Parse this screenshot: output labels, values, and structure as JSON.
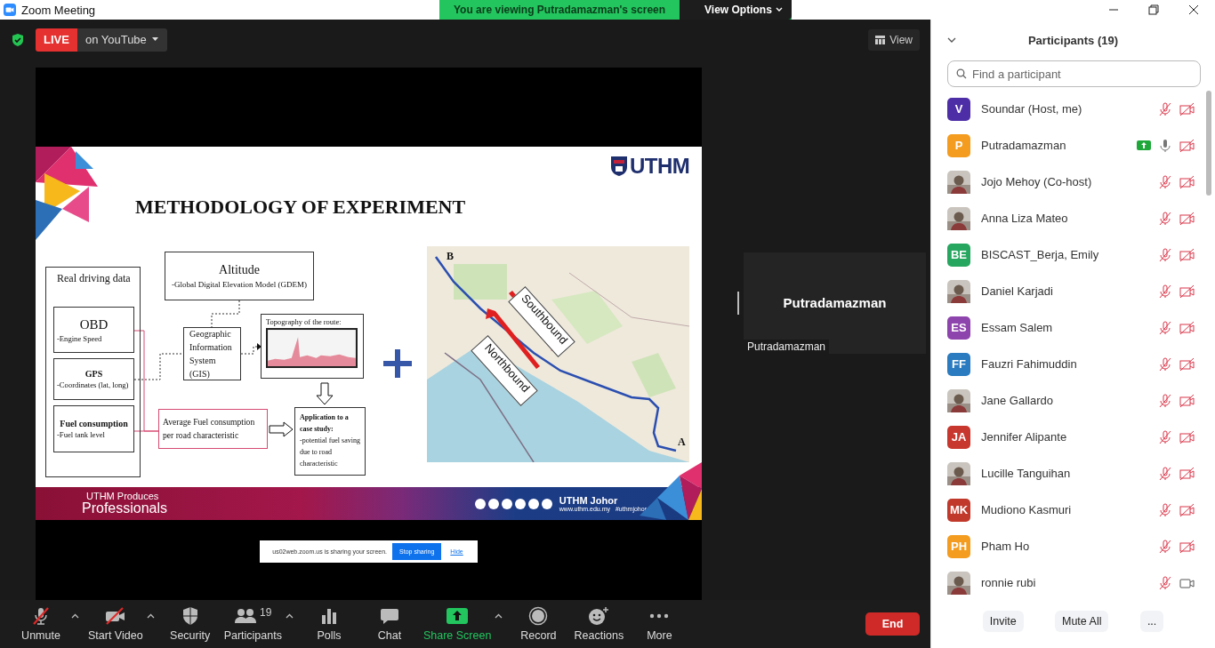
{
  "window": {
    "title": "Zoom Meeting"
  },
  "banner": {
    "text": "You are viewing Putradamazman's screen",
    "menu": "View Options"
  },
  "live": {
    "badge": "LIVE",
    "platform": "on YouTube"
  },
  "view_button": "View",
  "slide": {
    "logo": "UTHM",
    "title": "METHODOLOGY OF EXPERIMENT",
    "driving_data": {
      "title": "Real driving data",
      "items": [
        {
          "title": "OBD",
          "detail": "-Engine Speed",
          "bold": false
        },
        {
          "title": "GPS",
          "detail": "-Coordinates (lat, long)",
          "bold": true
        },
        {
          "title": "Fuel consumption",
          "detail": "-Fuel tank level",
          "bold": true
        }
      ]
    },
    "altitude": {
      "title": "Altitude",
      "detail": "-Global Digital Elevation Model (GDEM)"
    },
    "gis": "Geographic Information System (GIS)",
    "topography": "Topography of the route:",
    "average": "Average Fuel consumption per road characteristic",
    "application": {
      "title": "Application to a case study:",
      "detail": "-potential fuel saving due to road characteristic"
    },
    "map": {
      "kind": "picture",
      "labels": [
        "Southbound",
        "Northbound"
      ],
      "points": [
        "B",
        "A"
      ]
    },
    "footer": {
      "tagline": "UTHM Produces",
      "headline": "Professionals",
      "brand": "UTHM Johor",
      "website": "www.uthm.edu.my",
      "hashtag": "#uthmjohor"
    }
  },
  "share_notice": {
    "text": "us02web.zoom.us is sharing your screen.",
    "stop": "Stop sharing",
    "hide": "Hide"
  },
  "video_tile": {
    "name": "Putradamazman",
    "label": "Putradamazman"
  },
  "participants_panel": {
    "title": "Participants (19)",
    "search": {
      "placeholder": "Find a participant"
    },
    "participants": [
      {
        "name": "Soundar (Host, me)",
        "avatar": {
          "kind": "initials",
          "text": "V",
          "color": "#4e2ea6"
        },
        "sharing": false,
        "muted": true,
        "video_off": true
      },
      {
        "name": "Putradamazman",
        "avatar": {
          "kind": "initials",
          "text": "P",
          "color": "#f39c1f"
        },
        "sharing": true,
        "muted": false,
        "video_off": true
      },
      {
        "name": "Jojo Mehoy (Co-host)",
        "sharing": false,
        "muted": true,
        "video_off": true
      },
      {
        "name": "Anna Liza Mateo",
        "sharing": false,
        "muted": true,
        "video_off": true
      },
      {
        "name": "BISCAST_Berja, Emily",
        "avatar": {
          "kind": "initials",
          "text": "BE",
          "color": "#27a660"
        },
        "sharing": false,
        "muted": true,
        "video_off": true
      },
      {
        "name": "Daniel Karjadi",
        "sharing": false,
        "muted": true,
        "video_off": true
      },
      {
        "name": "Essam Salem",
        "avatar": {
          "kind": "initials",
          "text": "ES",
          "color": "#8e44ad"
        },
        "sharing": false,
        "muted": true,
        "video_off": true
      },
      {
        "name": "Fauzri Fahimuddin",
        "avatar": {
          "kind": "initials",
          "text": "FF",
          "color": "#2a7bbf"
        },
        "sharing": false,
        "muted": true,
        "video_off": true
      },
      {
        "name": "Jane Gallardo",
        "sharing": false,
        "muted": true,
        "video_off": true
      },
      {
        "name": "Jennifer Alipante",
        "avatar": {
          "kind": "initials",
          "text": "JA",
          "color": "#c8372d"
        },
        "sharing": false,
        "muted": true,
        "video_off": true
      },
      {
        "name": "Lucille Tanguihan",
        "sharing": false,
        "muted": true,
        "video_off": true
      },
      {
        "name": "Mudiono Kasmuri",
        "avatar": {
          "kind": "initials",
          "text": "MK",
          "color": "#c0392b"
        },
        "sharing": false,
        "muted": true,
        "video_off": true
      },
      {
        "name": "Pham Ho",
        "avatar": {
          "kind": "initials",
          "text": "PH",
          "color": "#f39c1f"
        },
        "sharing": false,
        "muted": true,
        "video_off": true
      },
      {
        "name": "ronnie rubi",
        "sharing": false,
        "muted": true,
        "video_off": false
      }
    ],
    "buttons": [
      "Invite",
      "Mute All",
      "..."
    ]
  },
  "toolbar": [
    {
      "kind": "mic",
      "label": "Unmute",
      "menu": true,
      "off": true
    },
    {
      "kind": "video",
      "label": "Start Video",
      "menu": true,
      "off": true
    },
    {
      "kind": "security",
      "label": "Security",
      "menu": false
    },
    {
      "kind": "participants",
      "label": "Participants",
      "count": "19",
      "menu": true
    },
    {
      "kind": "polls",
      "label": "Polls",
      "menu": false
    },
    {
      "kind": "chat",
      "label": "Chat",
      "menu": false
    },
    {
      "kind": "share",
      "label": "Share Screen",
      "menu": true
    },
    {
      "kind": "record",
      "label": "Record",
      "menu": false
    },
    {
      "kind": "reactions",
      "label": "Reactions",
      "menu": false
    },
    {
      "kind": "more",
      "label": "More",
      "menu": false
    }
  ],
  "end_button": "End"
}
